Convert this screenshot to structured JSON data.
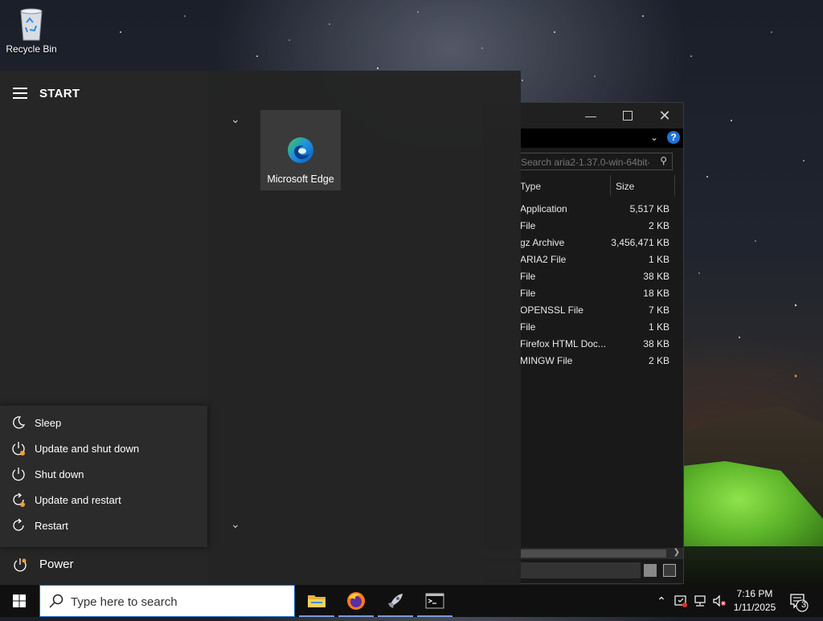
{
  "desktop": {
    "recycle_bin_label": "Recycle Bin"
  },
  "explorer": {
    "search_placeholder": "Search aria2-1.37.0-win-64bit-...",
    "columns": {
      "type": "Type",
      "size": "Size"
    },
    "rows": [
      {
        "type": "Application",
        "size": "5,517 KB"
      },
      {
        "type": "File",
        "size": "2 KB"
      },
      {
        "type": "gz Archive",
        "size": "3,456,471 KB"
      },
      {
        "type": "ARIA2 File",
        "size": "1 KB"
      },
      {
        "type": "File",
        "size": "38 KB"
      },
      {
        "type": "File",
        "size": "18 KB"
      },
      {
        "type": "OPENSSL File",
        "size": "7 KB"
      },
      {
        "type": "File",
        "size": "1 KB"
      },
      {
        "type": "Firefox HTML Doc...",
        "size": "38 KB"
      },
      {
        "type": "MINGW File",
        "size": "2 KB"
      }
    ],
    "help_glyph": "?"
  },
  "start": {
    "title": "START",
    "tiles": [
      {
        "label": "Microsoft Edge",
        "icon": "edge-icon"
      }
    ],
    "power_menu": [
      {
        "label": "Sleep",
        "icon": "moon-icon"
      },
      {
        "label": "Update and shut down",
        "icon": "power-update-icon"
      },
      {
        "label": "Shut down",
        "icon": "power-icon"
      },
      {
        "label": "Update and restart",
        "icon": "restart-update-icon"
      },
      {
        "label": "Restart",
        "icon": "restart-icon"
      }
    ],
    "power_label": "Power"
  },
  "taskbar": {
    "search_placeholder": "Type here to search",
    "apps": [
      "file-explorer-icon",
      "firefox-icon",
      "rocket-app-icon",
      "terminal-icon"
    ],
    "time": "7:16 PM",
    "date": "1/11/2025",
    "notification_count": "3"
  },
  "colors": {
    "accent": "#1b6ec2",
    "update_dot": "#f0a030",
    "edge_blue": "#1d8fe0",
    "edge_green": "#48c75a"
  }
}
